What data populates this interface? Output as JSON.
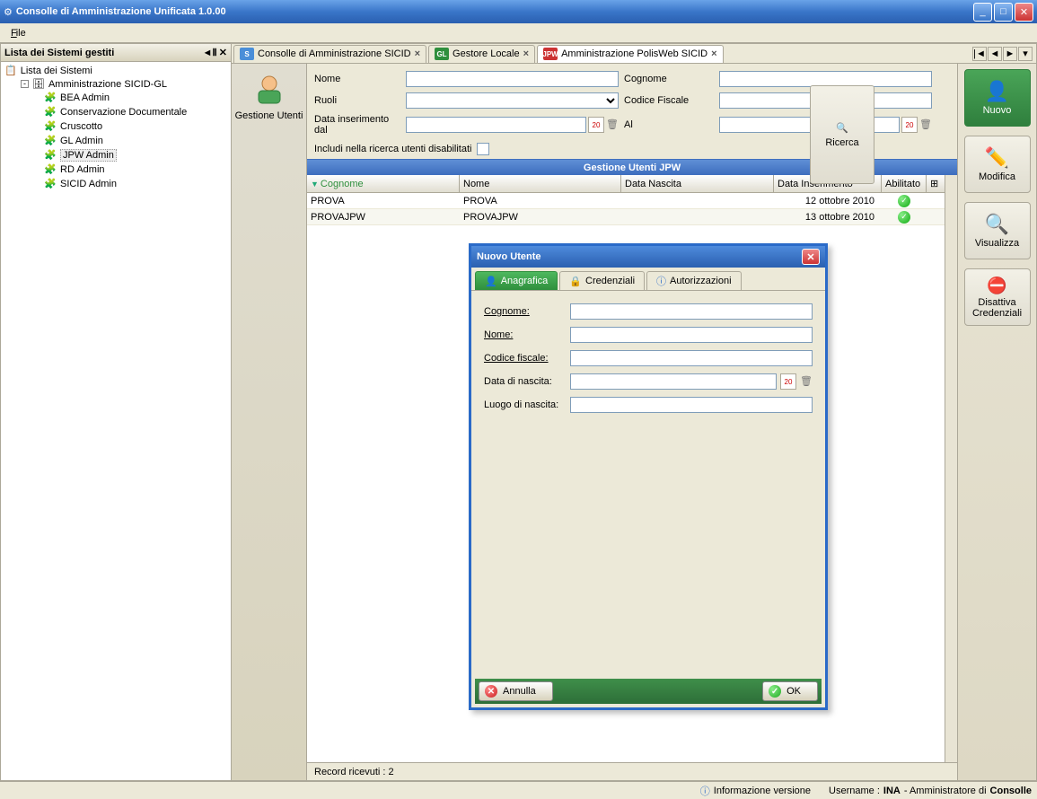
{
  "window": {
    "title": "Consolle di Amministrazione Unificata 1.0.00"
  },
  "menu": {
    "file": "File"
  },
  "sidebar": {
    "title": "Lista dei Sistemi gestiti",
    "root": "Lista dei Sistemi",
    "group": "Amministrazione SICID-GL",
    "items": [
      "BEA Admin",
      "Conservazione Documentale",
      "Cruscotto",
      "GL Admin",
      "JPW Admin",
      "RD Admin",
      "SICID Admin"
    ],
    "selected_index": 4
  },
  "tabs": {
    "items": [
      {
        "label": "Consolle di Amministrazione SICID",
        "color": "#4a8ed8"
      },
      {
        "label": "Gestore Locale",
        "color": "#2f8f3d",
        "badge": "GL"
      },
      {
        "label": "Amministrazione PolisWeb SICID",
        "color": "#c33",
        "badge": "JPW"
      }
    ]
  },
  "leftstrip": {
    "label": "Gestione Utenti"
  },
  "filters": {
    "nome_label": "Nome",
    "cognome_label": "Cognome",
    "ruoli_label": "Ruoli",
    "codice_fiscale_label": "Codice Fiscale",
    "data_dal_label": "Data inserimento dal",
    "al_label": "Al",
    "disab_label": "Includi nella ricerca utenti disabilitati",
    "ricerca_label": "Ricerca"
  },
  "grid": {
    "title": "Gestione Utenti JPW",
    "columns": [
      "Cognome",
      "Nome",
      "Data Nascita",
      "Data Inserimento",
      "Abilitato"
    ],
    "rows": [
      {
        "cognome": "PROVA",
        "nome": "PROVA",
        "nascita": "",
        "inserimento": "12 ottobre 2010",
        "abilitato": true
      },
      {
        "cognome": "PROVAJPW",
        "nome": "PROVAJPW",
        "nascita": "",
        "inserimento": "13 ottobre 2010",
        "abilitato": true
      }
    ]
  },
  "rightpanel": {
    "nuovo": "Nuovo",
    "modifica": "Modifica",
    "visualizza": "Visualizza",
    "disattiva": "Disattiva Credenziali"
  },
  "dialog": {
    "title": "Nuovo Utente",
    "tabs": {
      "anagrafica": "Anagrafica",
      "credenziali": "Credenziali",
      "autorizzazioni": "Autorizzazioni"
    },
    "fields": {
      "cognome": "Cognome:",
      "nome": "Nome:",
      "codice": "Codice fiscale:",
      "data": "Data di nascita:",
      "luogo": "Luogo di nascita:"
    },
    "buttons": {
      "annulla": "Annulla",
      "ok": "OK"
    }
  },
  "status": {
    "records": "Record ricevuti : 2"
  },
  "footer": {
    "info": "Informazione versione",
    "username_label": "Username : ",
    "username": "INA",
    "role": " - Amministratore di ",
    "app": "Consolle"
  }
}
